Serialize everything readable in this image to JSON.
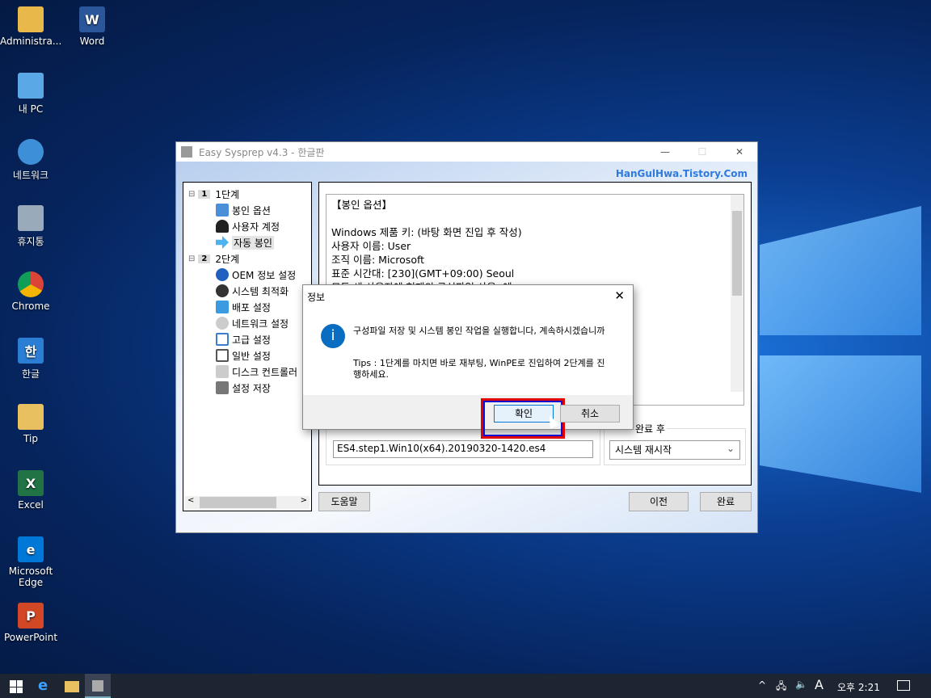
{
  "desktop": {
    "icons": [
      "Administra...",
      "Word",
      "내 PC",
      "네트워크",
      "휴지통",
      "Chrome",
      "한글",
      "Tip",
      "Excel",
      "Microsoft Edge",
      "PowerPoint"
    ]
  },
  "window": {
    "title": "Easy Sysprep v4.3 - 한글판",
    "brand": "HanGulHwa.Tistory.Com",
    "tree": [
      {
        "label": "1단계",
        "num": "1"
      },
      {
        "label": "봉인 옵션"
      },
      {
        "label": "사용자 계정"
      },
      {
        "label": "자동 봉인"
      },
      {
        "label": "2단계",
        "num": "2"
      },
      {
        "label": "OEM 정보 설정"
      },
      {
        "label": "시스템 최적화"
      },
      {
        "label": "배포 설정"
      },
      {
        "label": "네트워크 설정"
      },
      {
        "label": "고급 설정"
      },
      {
        "label": "일반 설정"
      },
      {
        "label": "디스크 컨트롤러"
      },
      {
        "label": "설정 저장"
      }
    ],
    "summary": [
      "【봉인 옵션】",
      "",
      "Windows 제품 키: (바탕 화면 진입 후 작성)",
      "사용자 이름: User",
      "조직 이름: Microsoft",
      "표준 시간대: [230](GMT+09:00) Seoul",
      "모든 새 사용자에 현재의 구성파일 사용: 예"
    ],
    "filename": "ES4.step1.Win10(x64).20190320-1420.es4",
    "after_label": "완료 후",
    "after_value": "시스템 재시작",
    "help": "도움말",
    "prev": "이전",
    "finish": "완료"
  },
  "dialog": {
    "title": "정보",
    "message": "구성파일 저장 및 시스템 봉인 작업을 실행합니다, 계속하시겠습니까",
    "tips": "Tips : 1단계를 마치면 바로 재부팅, WinPE로 진입하여 2단계를 진행하세요.",
    "ok": "확인",
    "cancel": "취소"
  },
  "taskbar": {
    "ime": "A",
    "clock": "오후 2:21"
  },
  "colors": {
    "accent": "#0078d7",
    "highlight": "#e00000"
  }
}
